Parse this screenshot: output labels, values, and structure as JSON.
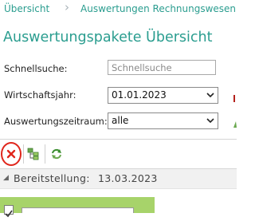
{
  "breadcrumb": {
    "items": [
      "Übersicht",
      "Auswertungen Rechnungswesen"
    ]
  },
  "page_title": "Auswertungspakete Übersicht",
  "filters": {
    "search_label": "Schnellsuche:",
    "search_placeholder": "Schnellsuche",
    "fiscal_year_label": "Wirtschaftsjahr:",
    "fiscal_year_value": "01.01.2023",
    "period_label": "Auswertungszeitraum:",
    "period_value": "alle"
  },
  "toolbar": {
    "buttons": [
      {
        "icon": "delete-x-icon",
        "highlighted": true
      },
      {
        "icon": "tree-structure-icon"
      },
      {
        "icon": "refresh-icon"
      }
    ]
  },
  "group": {
    "label": "Bereitstellung:",
    "date": "13.03.2023"
  },
  "colors": {
    "accent": "#2a9d8f",
    "row_highlight": "#a7d36a",
    "delete_red": "#e0261c"
  }
}
